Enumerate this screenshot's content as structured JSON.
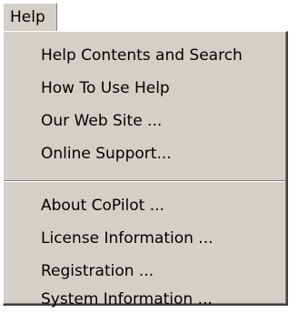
{
  "menu": {
    "title": "Help",
    "group_primary": [
      {
        "label": "Help Contents and Search"
      },
      {
        "label": "How To Use Help"
      },
      {
        "label": "Our Web Site ..."
      },
      {
        "label": "Online Support..."
      }
    ],
    "group_secondary": [
      {
        "label": "About CoPilot ..."
      },
      {
        "label": "License Information ..."
      },
      {
        "label": "Registration ..."
      },
      {
        "label": "System Information ..."
      }
    ]
  },
  "colors": {
    "menu_background": "#d4d0c8",
    "text": "#000000",
    "bevel_light": "#ffffff",
    "bevel_shadow": "#808080",
    "bevel_dark": "#404040"
  }
}
